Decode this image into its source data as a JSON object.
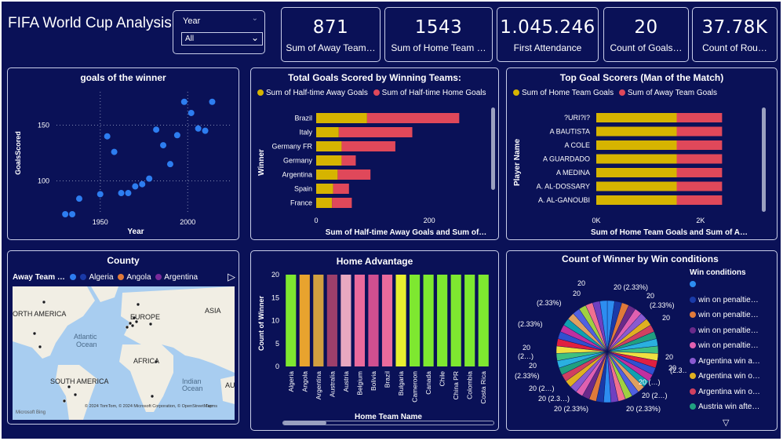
{
  "title": "FIFA World Cup Analysis",
  "slicer": {
    "label": "Year",
    "value": "All"
  },
  "kpis": [
    {
      "value": "871",
      "label": "Sum of Away Team…"
    },
    {
      "value": "1543",
      "label": "Sum of Home Team …"
    },
    {
      "value": "1.045.246",
      "label": "First Attendance"
    },
    {
      "value": "20",
      "label": "Count of Goals…"
    },
    {
      "value": "37.78K",
      "label": "Count of Rou…"
    }
  ],
  "colors": {
    "bg": "#0a1157",
    "yellow": "#d6b400",
    "red": "#e0485a",
    "blue": "#2d7df0"
  },
  "chart_data": [
    {
      "type": "scatter",
      "title": "goals of the winner",
      "xlabel": "Year",
      "ylabel": "GoalsScored",
      "xlim": [
        1925,
        2025
      ],
      "ylim": [
        70,
        180
      ],
      "xticks": [
        "1950",
        "2000"
      ],
      "yticks": [
        "100",
        "150"
      ],
      "points": [
        {
          "x": 1930,
          "y": 70
        },
        {
          "x": 1934,
          "y": 70
        },
        {
          "x": 1938,
          "y": 84
        },
        {
          "x": 1950,
          "y": 88
        },
        {
          "x": 1954,
          "y": 140
        },
        {
          "x": 1958,
          "y": 126
        },
        {
          "x": 1962,
          "y": 89
        },
        {
          "x": 1966,
          "y": 89
        },
        {
          "x": 1970,
          "y": 95
        },
        {
          "x": 1974,
          "y": 97
        },
        {
          "x": 1978,
          "y": 102
        },
        {
          "x": 1982,
          "y": 146
        },
        {
          "x": 1986,
          "y": 132
        },
        {
          "x": 1990,
          "y": 115
        },
        {
          "x": 1994,
          "y": 141
        },
        {
          "x": 1998,
          "y": 171
        },
        {
          "x": 2002,
          "y": 161
        },
        {
          "x": 2006,
          "y": 147
        },
        {
          "x": 2010,
          "y": 145
        },
        {
          "x": 2014,
          "y": 171
        }
      ]
    },
    {
      "type": "bar",
      "orientation": "horizontal",
      "title": "Total Goals Scored by Winning Teams:",
      "ylabel": "Winner",
      "xlabel": "Sum of Half-time Away Goals and Sum of…",
      "xlim": [
        0,
        290
      ],
      "xticks": [
        "0",
        "200"
      ],
      "categories": [
        "Brazil",
        "Italy",
        "Germany FR",
        "Germany",
        "Argentina",
        "Spain",
        "France"
      ],
      "series": [
        {
          "name": "Sum of Half-time Away Goals",
          "color": "#d6b400",
          "values": [
            90,
            40,
            45,
            45,
            38,
            30,
            28
          ]
        },
        {
          "name": "Sum of Half-time Home Goals",
          "color": "#e0485a",
          "values": [
            163,
            130,
            95,
            25,
            58,
            28,
            35
          ]
        }
      ]
    },
    {
      "type": "bar",
      "orientation": "horizontal",
      "title": "Top Goal Scorers (Man of the Match)",
      "ylabel": "Player Name",
      "xlabel": "Sum of Home Team Goals and Sum of A…",
      "xlim": [
        0,
        2800
      ],
      "xticks": [
        "0K",
        "2K"
      ],
      "categories": [
        "?URI?I?",
        "A BAUTISTA",
        "A COLE",
        "A GUARDADO",
        "A MEDINA",
        "A. AL-DOSSARY",
        "A. AL-GANOUBI"
      ],
      "series": [
        {
          "name": "Sum of Home Team Goals",
          "color": "#d6b400",
          "values": [
            1543,
            1543,
            1543,
            1543,
            1543,
            1543,
            1543
          ]
        },
        {
          "name": "Sum of Away Team Goals",
          "color": "#e0485a",
          "values": [
            871,
            871,
            871,
            871,
            871,
            871,
            871
          ]
        }
      ]
    },
    {
      "type": "bar",
      "title": "Home Advantage",
      "xlabel": "Home Team Name",
      "ylabel": "Count of Winner",
      "ylim": [
        0,
        20
      ],
      "yticks": [
        "0",
        "5",
        "10",
        "15",
        "20"
      ],
      "categories": [
        "Algeria",
        "Angola",
        "Argentina",
        "Australia",
        "Austria",
        "Belgium",
        "Bolivia",
        "Brazil",
        "Bulgaria",
        "Cameroon",
        "Canada",
        "Chile",
        "China PR",
        "Colombia",
        "Costa Rica"
      ],
      "values": [
        20,
        20,
        20,
        20,
        20,
        20,
        20,
        20,
        20,
        20,
        20,
        20,
        20,
        20,
        20
      ],
      "colors": [
        "#7ee830",
        "#e8a32e",
        "#d1a040",
        "#9c3f6b",
        "#e8a8c0",
        "#ea6a9c",
        "#d04f90",
        "#ea6a9c",
        "#e8f030",
        "#7ee830",
        "#7ee830",
        "#7ee830",
        "#7ee830",
        "#7ee830",
        "#7ee830"
      ]
    },
    {
      "type": "pie",
      "title": "Count of Winner by Win conditions",
      "legend_title": "Win conditions",
      "legend": [
        {
          "label": "",
          "color": "#2d8df0"
        },
        {
          "label": "win on penaltie…",
          "color": "#1a3aa8"
        },
        {
          "label": "win on penaltie…",
          "color": "#e07a3a"
        },
        {
          "label": "win on penaltie…",
          "color": "#6a2a8a"
        },
        {
          "label": "win on penaltie…",
          "color": "#e060b0"
        },
        {
          "label": "Argentina win a…",
          "color": "#8a5ad0"
        },
        {
          "label": "Argentina win o…",
          "color": "#e0b020"
        },
        {
          "label": "Argentina win o…",
          "color": "#d04060"
        },
        {
          "label": "Austria win afte…",
          "color": "#20a080"
        }
      ],
      "slice_count": 43,
      "slice_value": 20,
      "data_labels": [
        "20",
        "20 (2.33%)",
        "20",
        "(2.33%)",
        "20",
        "(2.33%)",
        "20",
        "(2.33%)",
        "20",
        "(2…)",
        "20",
        "(2.33%)",
        "20 (2…)",
        "20 (2.3…)",
        "20 (2.33%)",
        "20 (2.33%)",
        "20 (2…)",
        "20",
        "(2.3…)",
        "20 (…)",
        "20"
      ]
    },
    {
      "type": "map",
      "title": "County",
      "legend_title": "Away Team …",
      "legend": [
        {
          "label": "",
          "color": "#2d7df0"
        },
        {
          "label": "Algeria",
          "color": "#1a3aa8"
        },
        {
          "label": "Angola",
          "color": "#e07a3a"
        },
        {
          "label": "Argentina",
          "color": "#7a2a9a"
        }
      ],
      "place_labels": [
        "ORTH AMERICA",
        "Atlantic",
        "Ocean",
        "EUROPE",
        "ASIA",
        "AFRICA",
        "SOUTH AMERICA",
        "Indian",
        "Ocean",
        "AU"
      ],
      "attribution": "© 2024 TomTom, © 2024 Microsoft Corporation, © OpenStreetMap",
      "terms": "Terms",
      "brand": "Microsoft Bing"
    }
  ]
}
